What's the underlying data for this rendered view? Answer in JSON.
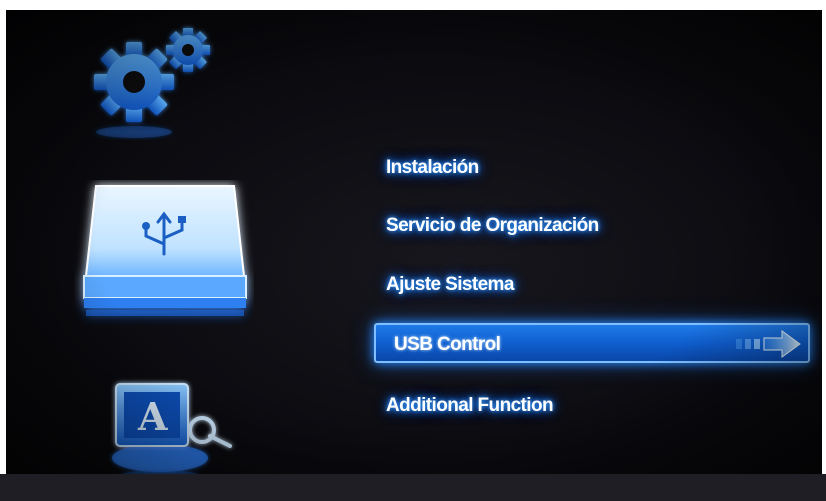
{
  "sidebar": {
    "icons": [
      "gear-icon",
      "usb-icon",
      "text-edit-icon"
    ],
    "selected_icon": "usb-icon"
  },
  "menu": {
    "items": [
      {
        "label": "Instalación"
      },
      {
        "label": "Servicio de Organización"
      },
      {
        "label": "Ajuste Sistema"
      },
      {
        "label": "USB Control"
      },
      {
        "label": "Additional Function"
      }
    ],
    "selected_index": 3
  },
  "colors": {
    "accent": "#1f7ae8",
    "glow": "#2a8cff",
    "background": "#0b0b10"
  }
}
